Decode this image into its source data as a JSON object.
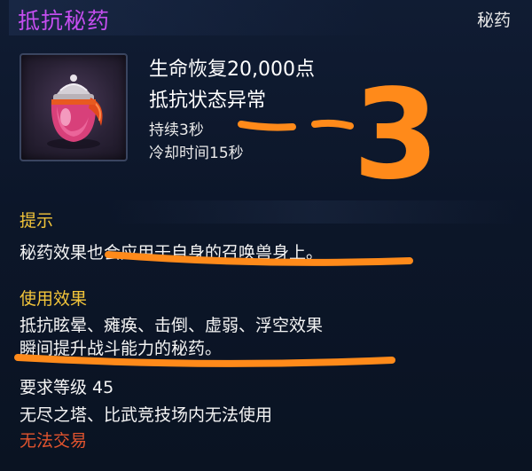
{
  "item": {
    "name": "抵抗秘药",
    "category": "秘药",
    "icon": "potion-jar-icon"
  },
  "stats": {
    "heal": "生命恢复20,000点",
    "resist": "抵抗状态异常",
    "duration": "持续3秒",
    "cooldown": "冷却时间15秒"
  },
  "tip": {
    "title": "提示",
    "text": "秘药效果也会应用于自身的召唤兽身上。"
  },
  "usage": {
    "title": "使用效果",
    "line1": "抵抗眩晕、瘫痪、击倒、虚弱、浮空效果",
    "line2": "瞬间提升战斗能力的秘药。"
  },
  "requirements": {
    "level": "要求等级 45",
    "restriction": "无尽之塔、比武竞技场内无法使用"
  },
  "trade_status": "无法交易",
  "annotation": {
    "number": "3",
    "color": "#ff8a1a"
  },
  "colors": {
    "item_name": "#c54ef0",
    "section_title": "#f3c53a",
    "untradable": "#e2542e"
  }
}
